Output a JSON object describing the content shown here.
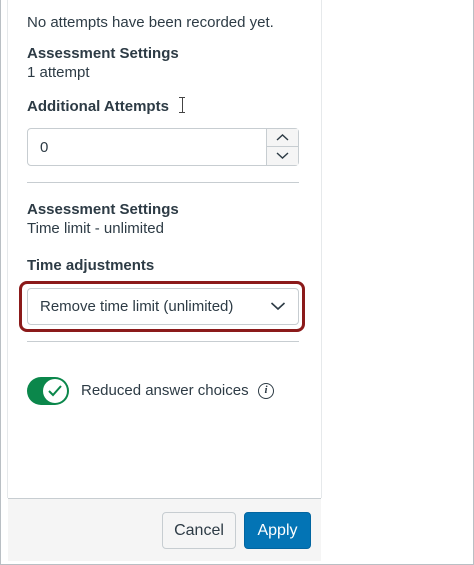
{
  "attempts_status": "No attempts have been recorded yet.",
  "assessment_settings_attempts": {
    "title": "Assessment Settings",
    "value": "1 attempt"
  },
  "additional_attempts": {
    "label": "Additional Attempts",
    "value": "0"
  },
  "assessment_settings_time": {
    "title": "Assessment Settings",
    "value": "Time limit - unlimited"
  },
  "time_adjustments": {
    "label": "Time adjustments",
    "selected": "Remove time limit (unlimited)"
  },
  "reduced_answer_choices": {
    "label": "Reduced answer choices",
    "enabled": true
  },
  "footer": {
    "cancel_label": "Cancel",
    "apply_label": "Apply"
  },
  "colors": {
    "toggle_on": "#0b874b",
    "apply_button": "#0374b5",
    "highlight_border": "#8b1a1a"
  },
  "icons": {
    "stepper_up": "chevron-up-icon",
    "stepper_down": "chevron-down-icon",
    "select": "chevron-down-icon",
    "toggle": "checkmark-icon",
    "info": "info-icon"
  }
}
